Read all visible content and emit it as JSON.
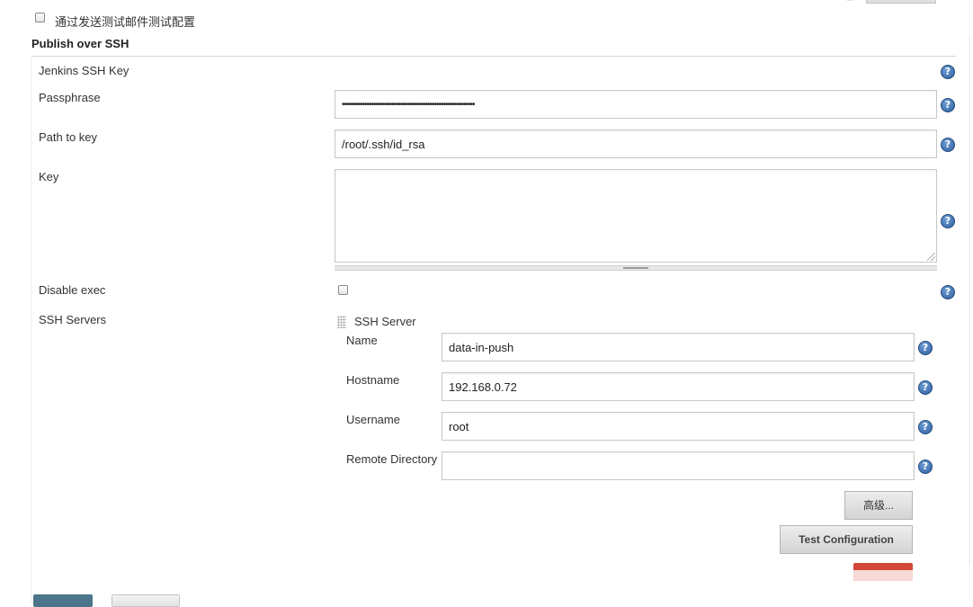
{
  "email_test": {
    "label": "通过发送测试邮件测试配置"
  },
  "section": {
    "title": "Publish over SSH"
  },
  "fields": {
    "jenkins_ssh_key": {
      "label": "Jenkins SSH Key"
    },
    "passphrase": {
      "label": "Passphrase",
      "value": "•••••••••••••••••••••••••••••••••••••••••••••••••••••••••••"
    },
    "path_to_key": {
      "label": "Path to key",
      "value": "/root/.ssh/id_rsa"
    },
    "key": {
      "label": "Key",
      "value": ""
    },
    "disable_exec": {
      "label": "Disable exec",
      "checked": false
    },
    "ssh_servers": {
      "label": "SSH Servers"
    }
  },
  "ssh_server": {
    "header": "SSH Server",
    "name": {
      "label": "Name",
      "value": "data-in-push"
    },
    "hostname": {
      "label": "Hostname",
      "value": "192.168.0.72"
    },
    "username": {
      "label": "Username",
      "value": "root"
    },
    "remote_directory": {
      "label": "Remote Directory",
      "value": ""
    },
    "advanced_button": "高级...",
    "test_button": "Test Configuration"
  },
  "icons": {
    "help": "help-icon",
    "grip": "drag-handle-icon"
  },
  "colors": {
    "help": "#2e5e9c",
    "primary_button": "#4b758b",
    "delete_button": "#d24939"
  }
}
